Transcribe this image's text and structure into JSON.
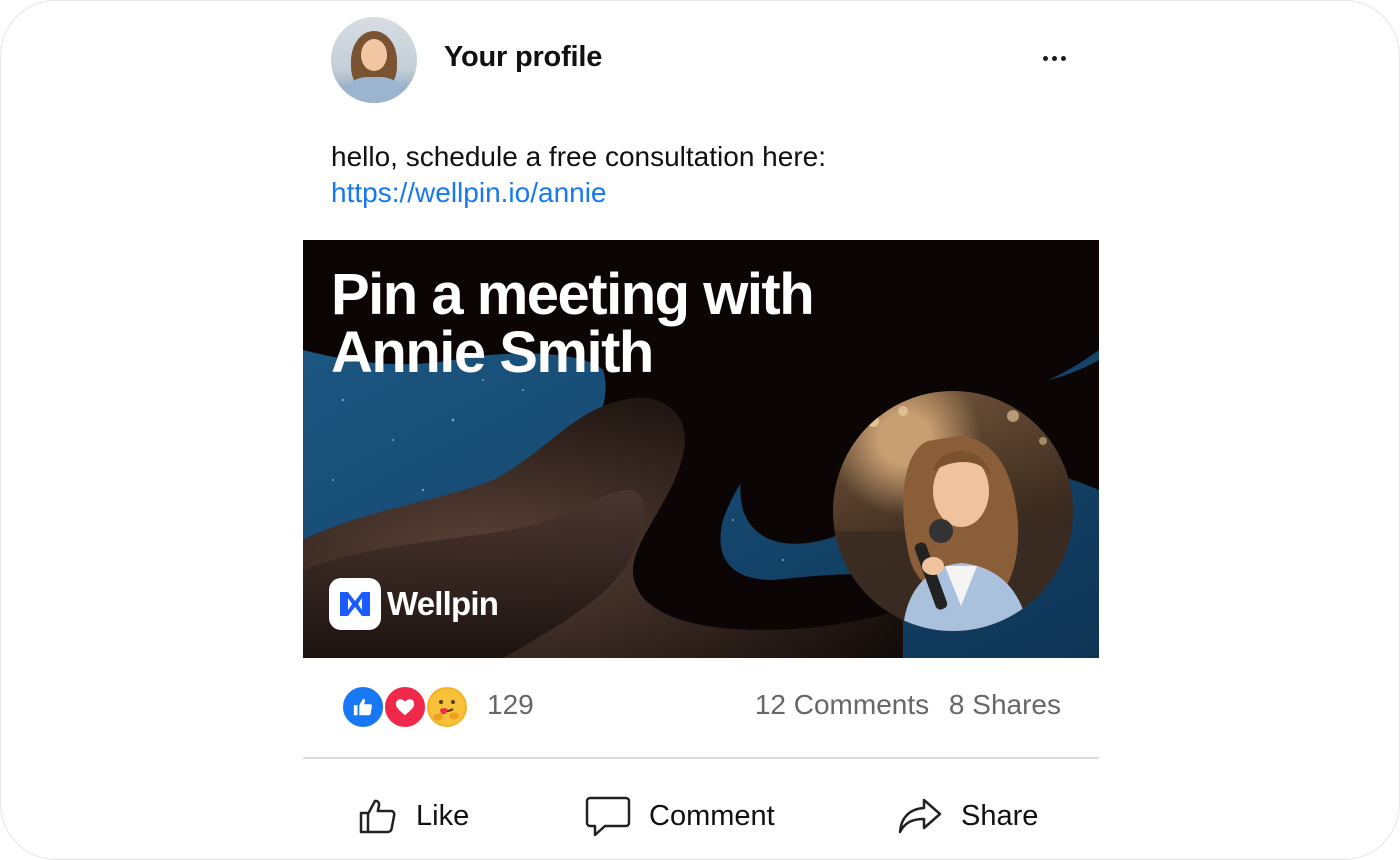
{
  "profile": {
    "name": "Your profile",
    "more_icon": "more-horizontal-icon"
  },
  "post": {
    "text": "hello, schedule a free consultation here:",
    "link": "https://wellpin.io/annie"
  },
  "banner": {
    "title_line1": "Pin a meeting with",
    "title_line2": "Annie Smith",
    "brand": "Wellpin",
    "brand_color": "#1a5cff"
  },
  "stats": {
    "reaction_count": "129",
    "comments": "12 Comments",
    "shares": "8 Shares",
    "reaction_icons": [
      "like-reaction-icon",
      "love-reaction-icon",
      "care-reaction-icon"
    ]
  },
  "actions": {
    "like": "Like",
    "comment": "Comment",
    "share": "Share"
  },
  "colors": {
    "link": "#1877f2",
    "like": "#1877f2",
    "love": "#f02849",
    "care": "#f7b125",
    "muted_text": "#65676b"
  }
}
